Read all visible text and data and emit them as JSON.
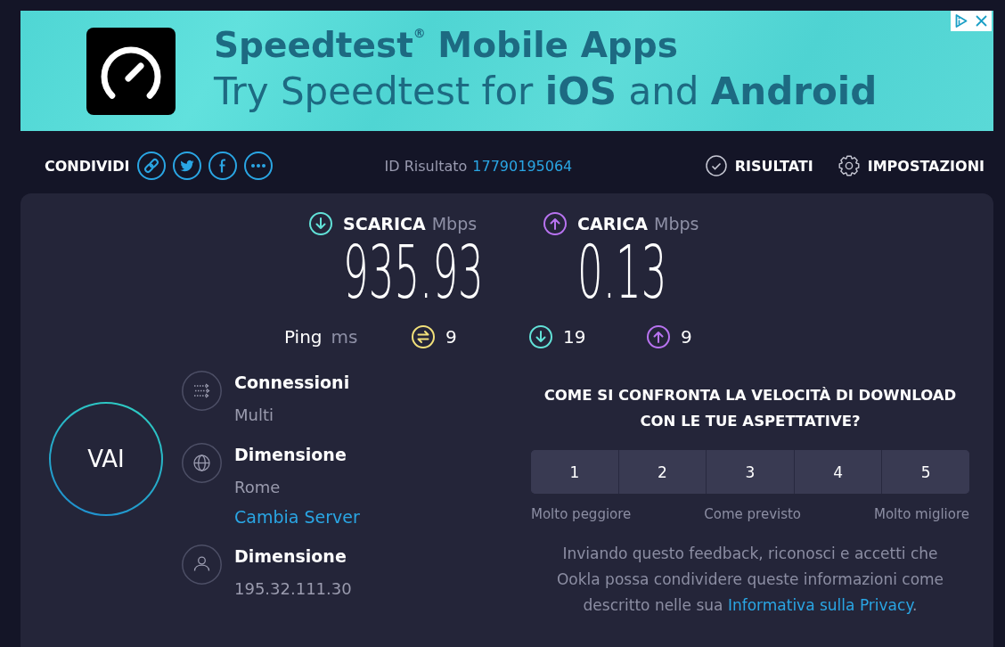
{
  "ad_banner": {
    "headline": "Speedtest$^{®}$ Mobile Apps",
    "tagline": "Try Speedtest for **iOS** and **Android**"
  },
  "toolbar": {
    "share_label": "CONDIVIDI",
    "share_buttons": [
      {
        "kind": "link"
      },
      {
        "kind": "twitter"
      },
      {
        "kind": "facebook"
      },
      {
        "kind": "more"
      }
    ],
    "result_id_label": "ID Risultato",
    "result_id": "17790195064",
    "nav": [
      {
        "kind": "results",
        "label": "RISULTATI"
      },
      {
        "kind": "settings",
        "label": "IMPOSTAZIONI"
      }
    ]
  },
  "results": [
    {
      "kind": "download",
      "label": "SCARICA",
      "unit": "Mbps",
      "value": "935.93"
    },
    {
      "kind": "upload",
      "label": "CARICA",
      "unit": "Mbps",
      "value": "0.13"
    }
  ],
  "ping": {
    "label": "Ping",
    "unit": "ms",
    "readings": [
      {
        "kind": "idle",
        "value": "9"
      },
      {
        "kind": "download",
        "value": "19"
      },
      {
        "kind": "upload",
        "value": "9"
      }
    ]
  },
  "start_button": "VAI",
  "details": [
    {
      "kind": "connections",
      "title": "Connessioni",
      "value": "Multi"
    },
    {
      "kind": "server",
      "title": "Dimensione",
      "value": "Rome",
      "link": "Cambia Server"
    },
    {
      "kind": "user",
      "title": "Dimensione",
      "value": "195.32.111.30"
    }
  ],
  "feedback": {
    "question": "COME SI CONFRONTA LA VELOCITÀ DI DOWNLOAD CON LE TUE ASPETTATIVE?",
    "ratings": [
      {
        "label": "1",
        "selected": false
      },
      {
        "label": "2",
        "selected": false
      },
      {
        "label": "3",
        "selected": false
      },
      {
        "label": "4",
        "selected": false
      },
      {
        "label": "5",
        "selected": false
      }
    ],
    "scale_labels": [
      "Molto peggiore",
      "Come previsto",
      "Molto migliore"
    ],
    "disclaimer": {
      "text": "Inviando questo feedback, riconosci e accetti che Ookla possa condividere queste informazioni come descritto nelle sua ",
      "link": "Informativa sulla Privacy",
      "text_after": "."
    }
  }
}
